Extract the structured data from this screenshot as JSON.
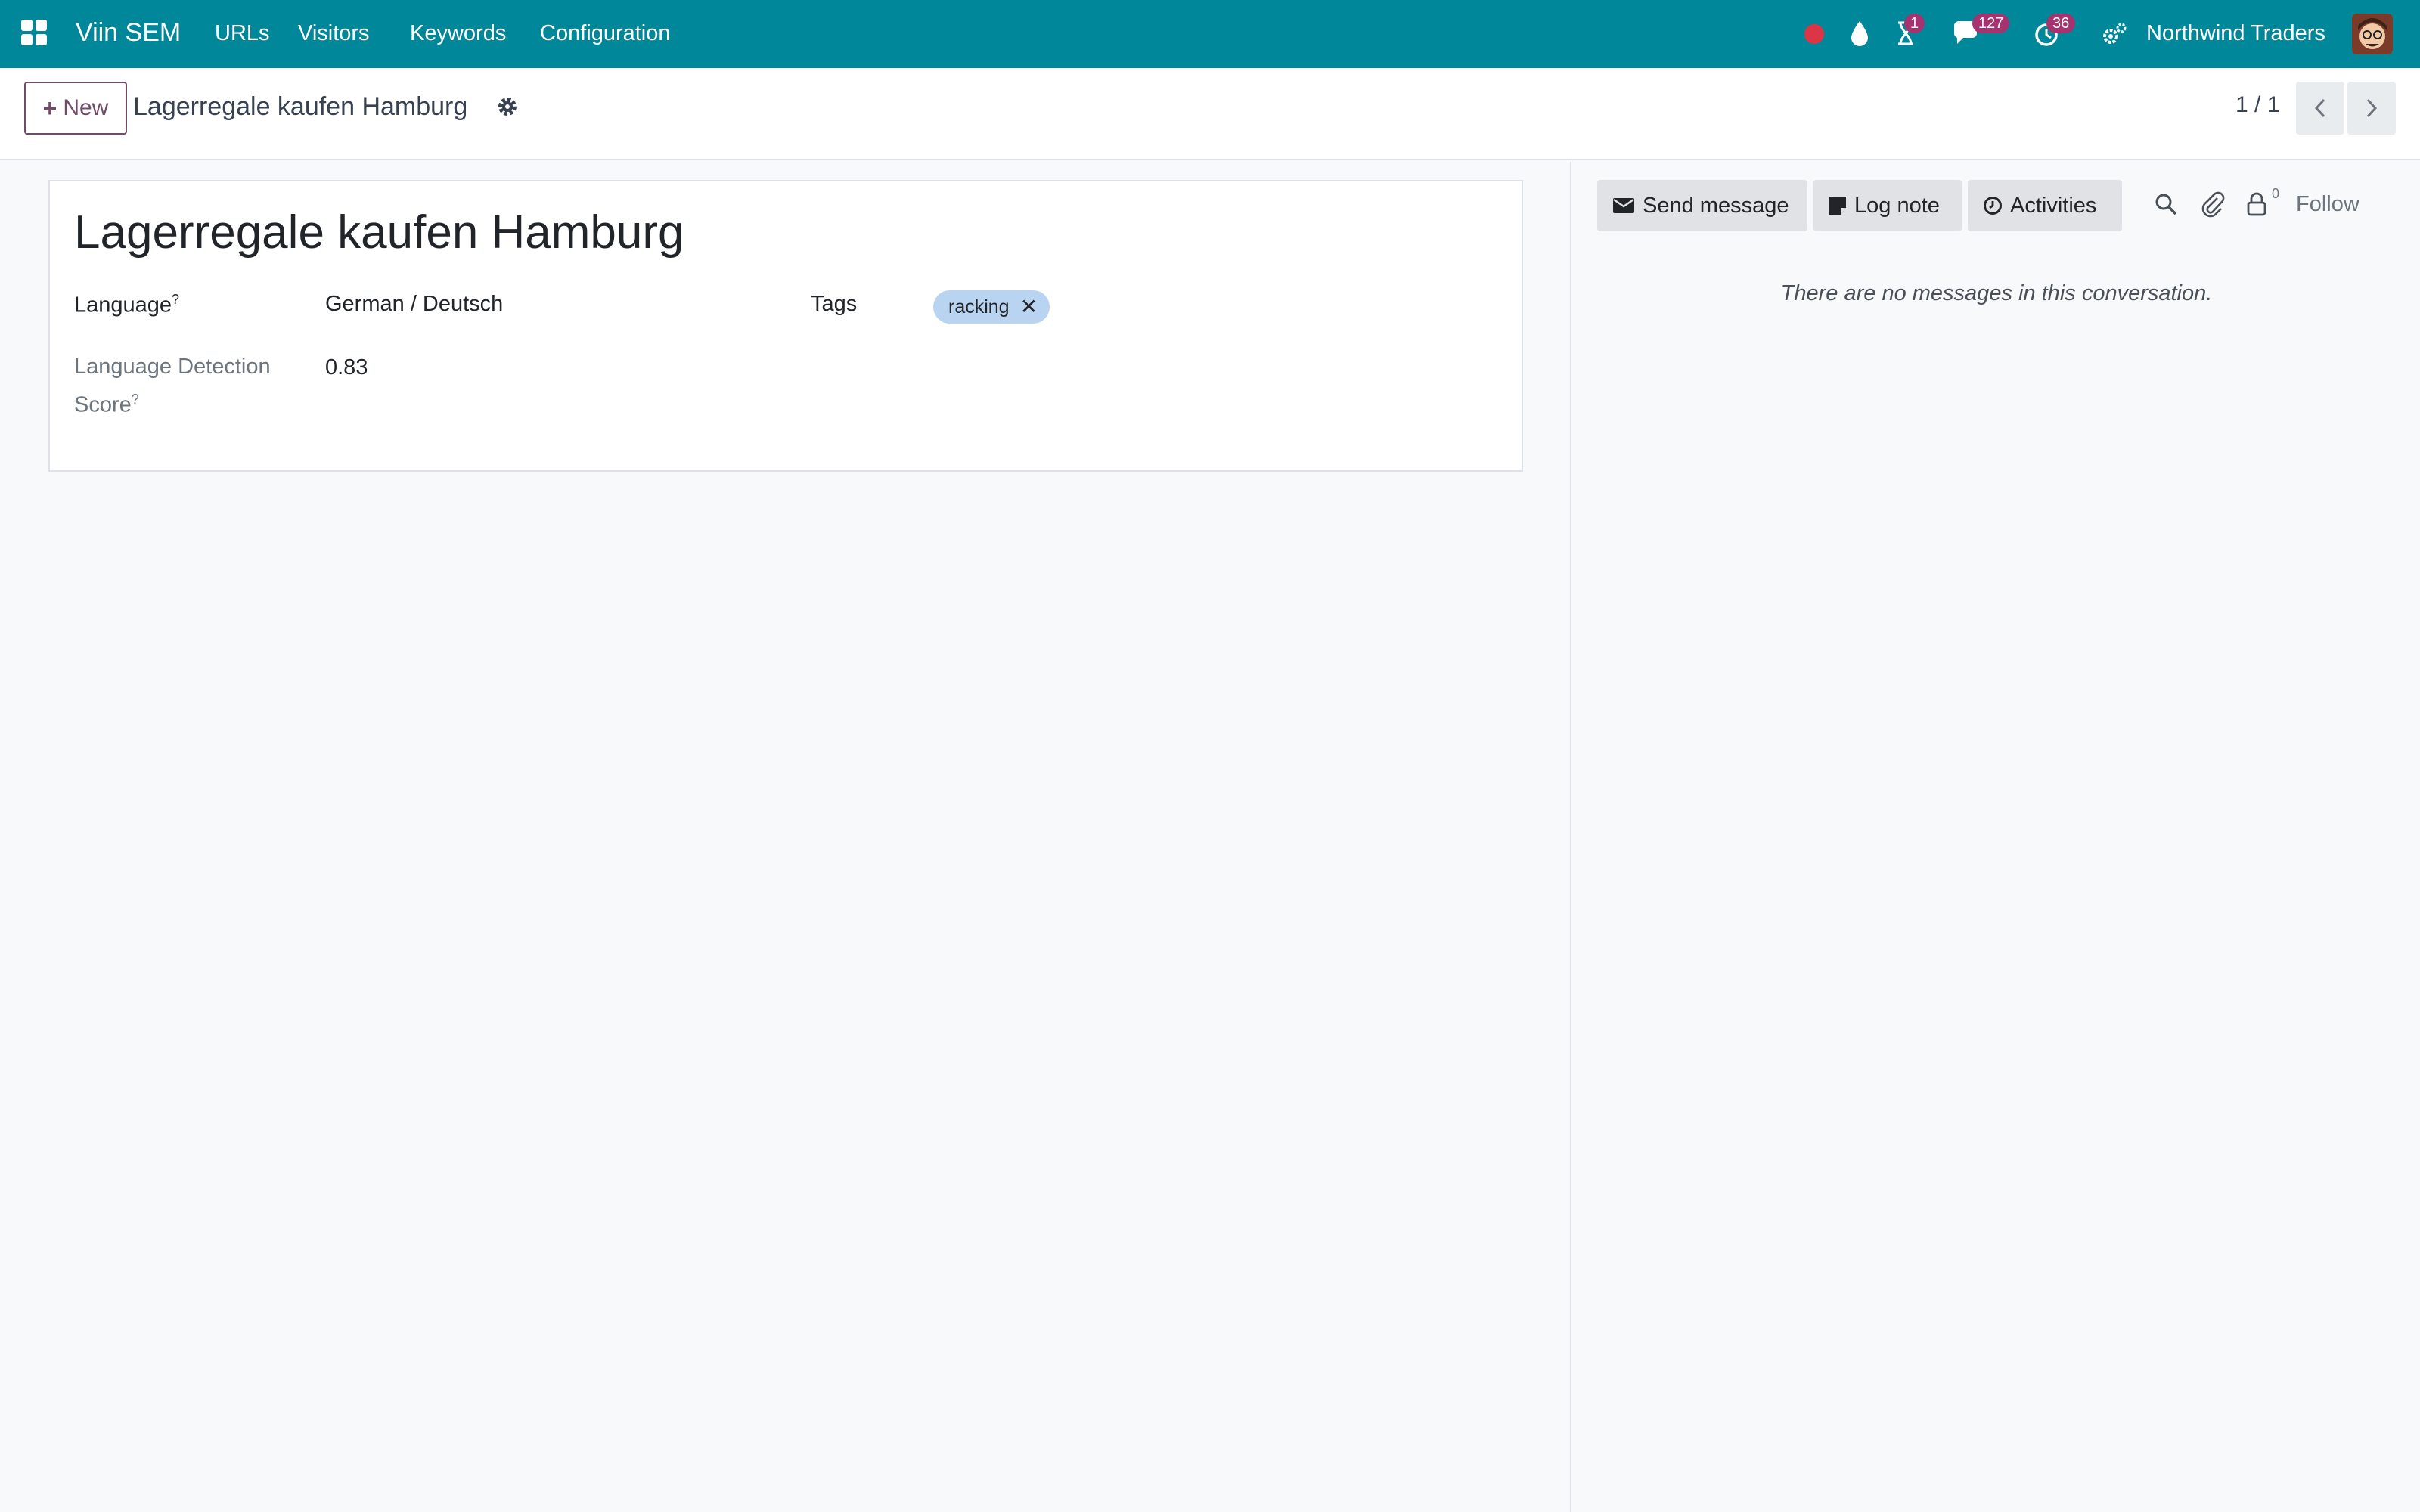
{
  "navbar": {
    "brand": "Viin SEM",
    "menu": [
      "URLs",
      "Visitors",
      "Keywords",
      "Configuration"
    ],
    "badges": {
      "activities_hourglass": "1",
      "messages": "127",
      "clock": "36"
    },
    "company": "Northwind Traders"
  },
  "control_panel": {
    "new_label": "New",
    "breadcrumb": "Lagerregale kaufen Hamburg",
    "pager": "1 / 1"
  },
  "form": {
    "title": "Lagerregale kaufen Hamburg",
    "language_label": "Language",
    "language_value": "German / Deutsch",
    "tags_label": "Tags",
    "tags": [
      "racking"
    ],
    "score_label_line1": "Language Detection",
    "score_label_line2": "Score",
    "score_value": "0.83",
    "help_mark": "?"
  },
  "chatter": {
    "send_message": "Send message",
    "log_note": "Log note",
    "activities": "Activities",
    "follower_count": "0",
    "follow": "Follow",
    "empty": "There are no messages in this conversation."
  },
  "colors": {
    "navbar": "#00879a",
    "primary": "#714b67",
    "badge": "#a4336f",
    "tag": "#b9d4f1",
    "status_dot": "#dc3545"
  }
}
